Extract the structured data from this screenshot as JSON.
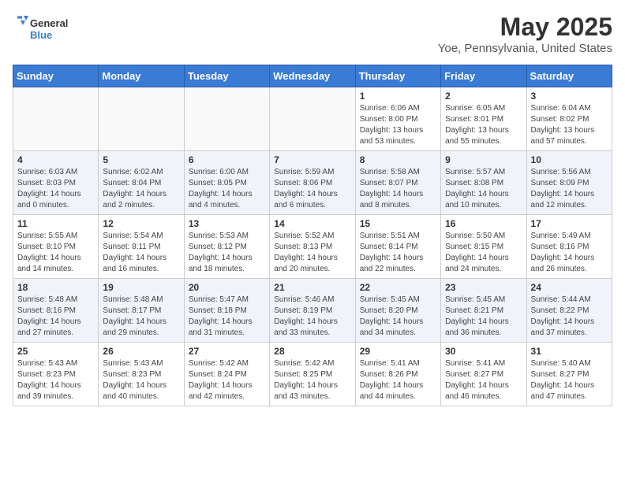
{
  "logo": {
    "general": "General",
    "blue": "Blue"
  },
  "title": "May 2025",
  "subtitle": "Yoe, Pennsylvania, United States",
  "days_header": [
    "Sunday",
    "Monday",
    "Tuesday",
    "Wednesday",
    "Thursday",
    "Friday",
    "Saturday"
  ],
  "weeks": [
    [
      {
        "day": "",
        "info": ""
      },
      {
        "day": "",
        "info": ""
      },
      {
        "day": "",
        "info": ""
      },
      {
        "day": "",
        "info": ""
      },
      {
        "day": "1",
        "info": "Sunrise: 6:06 AM\nSunset: 8:00 PM\nDaylight: 13 hours\nand 53 minutes."
      },
      {
        "day": "2",
        "info": "Sunrise: 6:05 AM\nSunset: 8:01 PM\nDaylight: 13 hours\nand 55 minutes."
      },
      {
        "day": "3",
        "info": "Sunrise: 6:04 AM\nSunset: 8:02 PM\nDaylight: 13 hours\nand 57 minutes."
      }
    ],
    [
      {
        "day": "4",
        "info": "Sunrise: 6:03 AM\nSunset: 8:03 PM\nDaylight: 14 hours\nand 0 minutes."
      },
      {
        "day": "5",
        "info": "Sunrise: 6:02 AM\nSunset: 8:04 PM\nDaylight: 14 hours\nand 2 minutes."
      },
      {
        "day": "6",
        "info": "Sunrise: 6:00 AM\nSunset: 8:05 PM\nDaylight: 14 hours\nand 4 minutes."
      },
      {
        "day": "7",
        "info": "Sunrise: 5:59 AM\nSunset: 8:06 PM\nDaylight: 14 hours\nand 6 minutes."
      },
      {
        "day": "8",
        "info": "Sunrise: 5:58 AM\nSunset: 8:07 PM\nDaylight: 14 hours\nand 8 minutes."
      },
      {
        "day": "9",
        "info": "Sunrise: 5:57 AM\nSunset: 8:08 PM\nDaylight: 14 hours\nand 10 minutes."
      },
      {
        "day": "10",
        "info": "Sunrise: 5:56 AM\nSunset: 8:09 PM\nDaylight: 14 hours\nand 12 minutes."
      }
    ],
    [
      {
        "day": "11",
        "info": "Sunrise: 5:55 AM\nSunset: 8:10 PM\nDaylight: 14 hours\nand 14 minutes."
      },
      {
        "day": "12",
        "info": "Sunrise: 5:54 AM\nSunset: 8:11 PM\nDaylight: 14 hours\nand 16 minutes."
      },
      {
        "day": "13",
        "info": "Sunrise: 5:53 AM\nSunset: 8:12 PM\nDaylight: 14 hours\nand 18 minutes."
      },
      {
        "day": "14",
        "info": "Sunrise: 5:52 AM\nSunset: 8:13 PM\nDaylight: 14 hours\nand 20 minutes."
      },
      {
        "day": "15",
        "info": "Sunrise: 5:51 AM\nSunset: 8:14 PM\nDaylight: 14 hours\nand 22 minutes."
      },
      {
        "day": "16",
        "info": "Sunrise: 5:50 AM\nSunset: 8:15 PM\nDaylight: 14 hours\nand 24 minutes."
      },
      {
        "day": "17",
        "info": "Sunrise: 5:49 AM\nSunset: 8:16 PM\nDaylight: 14 hours\nand 26 minutes."
      }
    ],
    [
      {
        "day": "18",
        "info": "Sunrise: 5:48 AM\nSunset: 8:16 PM\nDaylight: 14 hours\nand 27 minutes."
      },
      {
        "day": "19",
        "info": "Sunrise: 5:48 AM\nSunset: 8:17 PM\nDaylight: 14 hours\nand 29 minutes."
      },
      {
        "day": "20",
        "info": "Sunrise: 5:47 AM\nSunset: 8:18 PM\nDaylight: 14 hours\nand 31 minutes."
      },
      {
        "day": "21",
        "info": "Sunrise: 5:46 AM\nSunset: 8:19 PM\nDaylight: 14 hours\nand 33 minutes."
      },
      {
        "day": "22",
        "info": "Sunrise: 5:45 AM\nSunset: 8:20 PM\nDaylight: 14 hours\nand 34 minutes."
      },
      {
        "day": "23",
        "info": "Sunrise: 5:45 AM\nSunset: 8:21 PM\nDaylight: 14 hours\nand 36 minutes."
      },
      {
        "day": "24",
        "info": "Sunrise: 5:44 AM\nSunset: 8:22 PM\nDaylight: 14 hours\nand 37 minutes."
      }
    ],
    [
      {
        "day": "25",
        "info": "Sunrise: 5:43 AM\nSunset: 8:23 PM\nDaylight: 14 hours\nand 39 minutes."
      },
      {
        "day": "26",
        "info": "Sunrise: 5:43 AM\nSunset: 8:23 PM\nDaylight: 14 hours\nand 40 minutes."
      },
      {
        "day": "27",
        "info": "Sunrise: 5:42 AM\nSunset: 8:24 PM\nDaylight: 14 hours\nand 42 minutes."
      },
      {
        "day": "28",
        "info": "Sunrise: 5:42 AM\nSunset: 8:25 PM\nDaylight: 14 hours\nand 43 minutes."
      },
      {
        "day": "29",
        "info": "Sunrise: 5:41 AM\nSunset: 8:26 PM\nDaylight: 14 hours\nand 44 minutes."
      },
      {
        "day": "30",
        "info": "Sunrise: 5:41 AM\nSunset: 8:27 PM\nDaylight: 14 hours\nand 46 minutes."
      },
      {
        "day": "31",
        "info": "Sunrise: 5:40 AM\nSunset: 8:27 PM\nDaylight: 14 hours\nand 47 minutes."
      }
    ]
  ]
}
